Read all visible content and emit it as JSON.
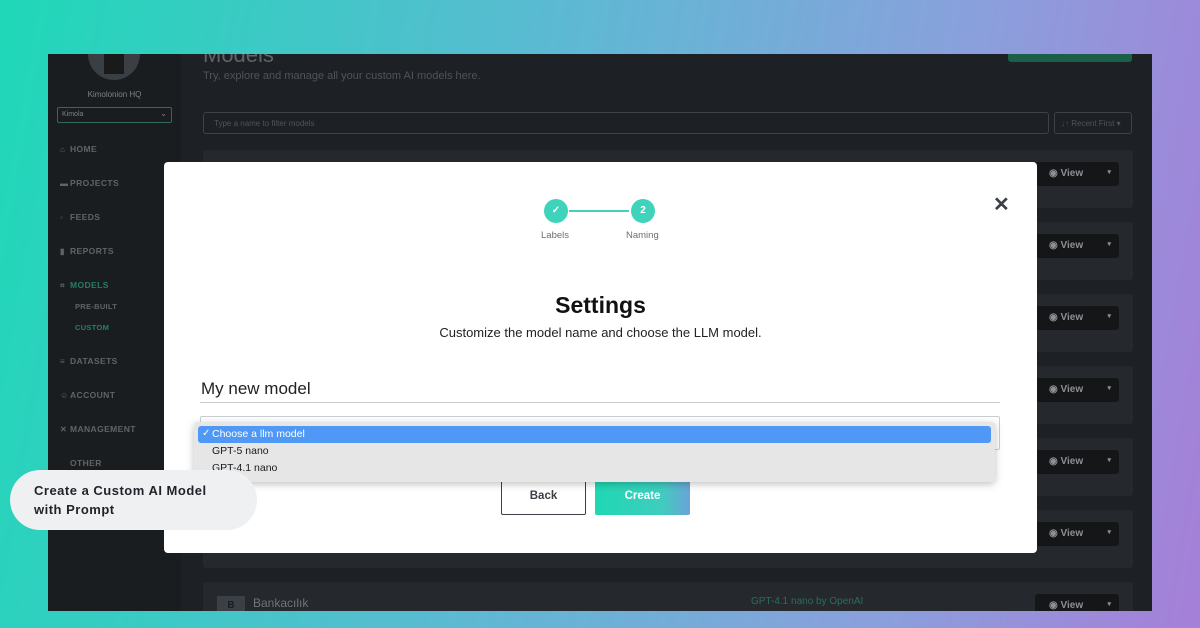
{
  "sidebar": {
    "org_name": "Kimolonion HQ",
    "org_select": "Kimola",
    "items": [
      {
        "label": "HOME",
        "icon": "home-icon"
      },
      {
        "label": "PROJECTS",
        "icon": "folder-icon"
      },
      {
        "label": "FEEDS",
        "icon": "feed-icon"
      },
      {
        "label": "REPORTS",
        "icon": "chart-icon"
      },
      {
        "label": "MODELS",
        "icon": "models-icon"
      },
      {
        "label": "DATASETS",
        "icon": "database-icon"
      },
      {
        "label": "ACCOUNT",
        "icon": "user-icon"
      },
      {
        "label": "MANAGEMENT",
        "icon": "tools-icon"
      },
      {
        "label": "OTHER",
        "icon": ""
      }
    ],
    "sub_items": [
      "PRE-BUILT",
      "CUSTOM"
    ]
  },
  "main": {
    "title": "Models",
    "subtitle": "Try, explore and manage all your custom AI models here.",
    "filter_placeholder": "Type a name to filter models",
    "sort_label": "↓↑ Recent First ▾",
    "view_label": "View",
    "last_row": {
      "badge": "B",
      "name": "Bankacılık",
      "model": "GPT-4.1 nano by OpenAI"
    }
  },
  "modal": {
    "steps": [
      {
        "label": "Labels",
        "marker": "✓"
      },
      {
        "label": "Naming",
        "marker": "2"
      }
    ],
    "close": "✕",
    "title": "Settings",
    "subtitle": "Customize the model name and choose the LLM model.",
    "name_value": "My new model",
    "back_label": "Back",
    "create_label": "Create"
  },
  "dropdown": {
    "options": [
      "Choose a llm model",
      "GPT-5 nano",
      "GPT-4.1 nano"
    ],
    "selected_index": 0
  },
  "caption": {
    "text": "Create a Custom AI Model with Prompt"
  }
}
